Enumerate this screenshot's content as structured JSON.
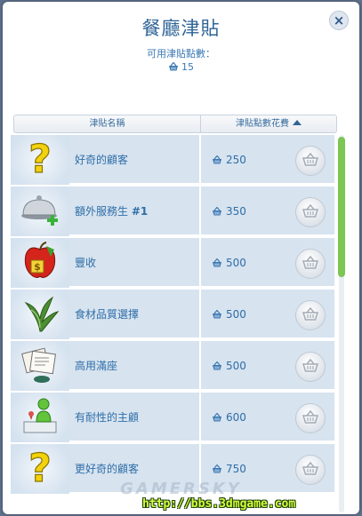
{
  "dialog": {
    "title": "餐廳津貼",
    "points_label": "可用津貼點數：",
    "points_value": "15",
    "close_label": "×"
  },
  "table": {
    "col_name": "津貼名稱",
    "col_cost": "津貼點數花費"
  },
  "perks": [
    {
      "name": "好奇的顧客",
      "suffix": "",
      "cost": "250",
      "icon": "question-mark-icon"
    },
    {
      "name": "額外服務生 ",
      "suffix": "#1",
      "cost": "350",
      "icon": "serving-cloche-plus-icon"
    },
    {
      "name": "豐收",
      "suffix": "",
      "cost": "500",
      "icon": "apple-money-icon"
    },
    {
      "name": "食材品質選擇",
      "suffix": "",
      "cost": "500",
      "icon": "leafy-greens-icon"
    },
    {
      "name": "高用滿座",
      "suffix": "",
      "cost": "500",
      "icon": "menu-papers-icon"
    },
    {
      "name": "有耐性的主顧",
      "suffix": "",
      "cost": "600",
      "icon": "patient-customer-icon"
    },
    {
      "name": "更好奇的顧客",
      "suffix": "",
      "cost": "750",
      "icon": "question-mark-icon"
    }
  ],
  "watermark": "GAMERSKY",
  "url": "http://bbs.3dmgame.com",
  "colors": {
    "title": "#2f6496",
    "row_bg": "#d7e3ef",
    "scroll_thumb": "#7cc653"
  }
}
